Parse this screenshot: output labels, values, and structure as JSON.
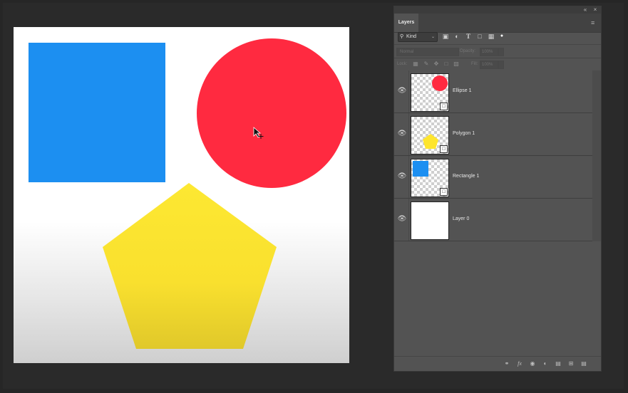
{
  "panel": {
    "tab_label": "Layers",
    "filter": {
      "kind_label": "Kind",
      "icons": [
        "image-filter-icon",
        "adjustment-filter-icon",
        "type-filter-icon",
        "shape-filter-icon",
        "smart-object-filter-icon"
      ],
      "toggle": "filter-toggle-icon"
    },
    "blend": {
      "mode": "Normal",
      "opacity_label": "Opacity:",
      "opacity_value": "100%"
    },
    "lock": {
      "label": "Lock:",
      "fill_label": "Fill:",
      "fill_value": "100%"
    },
    "layers": [
      {
        "name": "Ellipse 1",
        "visible": true,
        "thumb": "ellipse",
        "color": "#ff2a40"
      },
      {
        "name": "Polygon 1",
        "visible": true,
        "thumb": "polygon",
        "color": "#fee52e"
      },
      {
        "name": "Rectangle 1",
        "visible": true,
        "thumb": "rectangle",
        "color": "#1c8ff1"
      },
      {
        "name": "Layer 0",
        "visible": true,
        "thumb": "solid-white",
        "color": "#ffffff"
      }
    ],
    "bottom_icons": [
      "link-layers-icon",
      "layer-style-icon",
      "layer-mask-icon",
      "adjustment-layer-icon",
      "group-folder-icon",
      "new-layer-icon",
      "delete-layer-icon"
    ]
  },
  "canvas": {
    "background": "#ffffff",
    "shapes": [
      {
        "name": "blue-rectangle",
        "color": "#1c8ff1"
      },
      {
        "name": "red-ellipse",
        "color": "#ff2a40"
      },
      {
        "name": "yellow-pentagon",
        "color": "#fee52e"
      }
    ]
  }
}
